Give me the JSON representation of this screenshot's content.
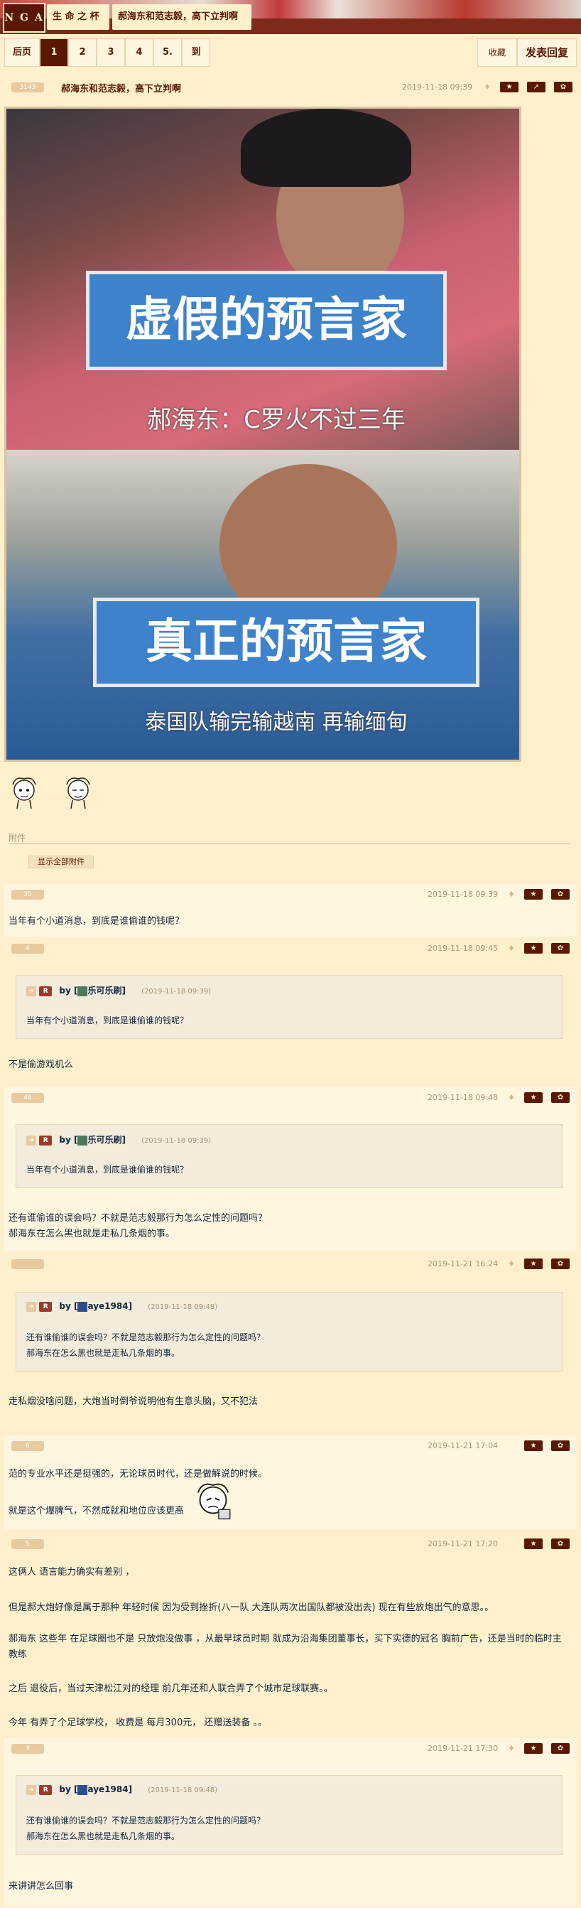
{
  "header": {
    "logo": "N G A",
    "breadcrumb": [
      "生 命 之 杯",
      "郝海东和范志毅，高下立判啊"
    ]
  },
  "pager": {
    "first": "后页",
    "pages": [
      "1",
      "2",
      "3",
      "4",
      "5."
    ],
    "goto": "到",
    "favorite": "收藏",
    "reply": "发表回复"
  },
  "post0": {
    "floor": "3143",
    "title": "郝海东和范志毅，高下立判啊",
    "date": "2019-11-18 09:39",
    "image": {
      "banner1": "虚假的预言家",
      "caption1": "郝海东：C罗火不过三年",
      "banner2": "真正的预言家",
      "caption2": "泰国队输完输越南 再输缅甸"
    },
    "attach_label": "附件",
    "attach_button": "显示全部附件"
  },
  "posts": [
    {
      "floor": "35",
      "date": "2019-11-18 09:39",
      "lines": [
        "当年有个小道消息，到底是谁偷谁的钱呢？"
      ]
    },
    {
      "floor": "4",
      "date": "2019-11-18 09:45",
      "quote": {
        "user": "乐可乐刷",
        "date": "(2019-11-18 09:39)",
        "lines": [
          "当年有个小道消息，到底是谁偷谁的钱呢？"
        ]
      },
      "lines": [
        "不是偷游戏机么"
      ]
    },
    {
      "floor": "46",
      "date": "2019-11-18 09:48",
      "quote": {
        "user": "乐可乐刷",
        "date": "(2019-11-18 09:39)",
        "lines": [
          "当年有个小道消息，到底是谁偷谁的钱呢？"
        ]
      },
      "lines": [
        "还有谁偷谁的误会吗？不就是范志毅那行为怎么定性的问题吗？",
        "郝海东在怎么黑也就是走私几条烟的事。"
      ]
    },
    {
      "floor": "",
      "date": "2019-11-21 16:24",
      "quote": {
        "user": "aye1984",
        "date": "(2019-11-18 09:48)",
        "lines": [
          "还有谁偷谁的误会吗？不就是范志毅那行为怎么定性的问题吗？",
          "郝海东在怎么黑也就是走私几条烟的事。"
        ]
      },
      "lines": [
        "走私烟没啥问题，大炮当时倒爷说明他有生意头脑，又不犯法"
      ]
    },
    {
      "floor": "6",
      "date": "2019-11-21 17:04",
      "lines": [
        "范的专业水平还是挺强的，无论球员时代，还是做解说的时候。",
        "就是这个爆脾气，不然成就和地位应该更高"
      ]
    },
    {
      "floor": "5",
      "date": "2019-11-21 17:20",
      "lines": [
        "这俩人 语言能力确实有差别 ，",
        "但是郝大炮好像是属于那种 年轻时候 因为受到挫折(八一队 大连队两次出国队都被没出去) 现在有些放炮出气的意思。。",
        "郝海东 这些年 在足球圈也不是 只放炮没做事 ，从最早球员时期 就成为沿海集团董事长，买下实德的冠名 胸前广告，还是当时的临时主教练",
        "之后 退役后，当过天津松江对的经理 前几年还和人联合弄了个城市足球联赛。。",
        "今年 有弄了个足球学校，  收费是 每月300元，  还赠送装备 。。"
      ]
    },
    {
      "floor": "3",
      "date": "2019-11-21 17:30",
      "quote": {
        "user": "aye1984",
        "date": "(2019-11-18 09:48)",
        "lines": [
          "还有谁偷谁的误会吗？不就是范志毅那行为怎么定性的问题吗？",
          "郝海东在怎么黑也就是走私几条烟的事。"
        ]
      },
      "lines": [
        "来讲讲怎么回事"
      ]
    }
  ],
  "common": {
    "by": "by",
    "star": "★",
    "gear": "✿",
    "share": "➚",
    "fav": "♦",
    "arrow": "➔",
    "r": "R"
  },
  "colors": {
    "accent": "#591804",
    "background": "#fff0cd",
    "alt_row": "#fff6df"
  }
}
